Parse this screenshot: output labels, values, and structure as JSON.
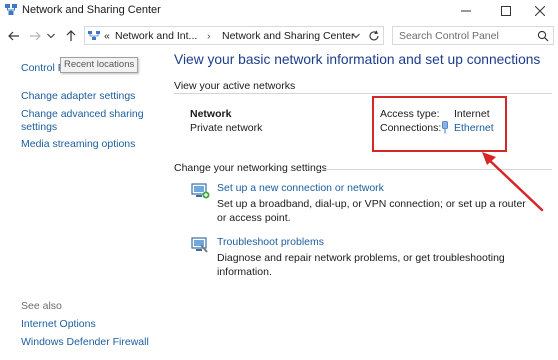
{
  "window": {
    "title": "Network and Sharing Center",
    "minimize_icon": "minimize-icon",
    "maximize_icon": "maximize-icon",
    "close_icon": "close-icon"
  },
  "address_bar": {
    "overflow_chevrons": "«",
    "crumbs": [
      "Network and Int...",
      "Network and Sharing Center"
    ],
    "search_placeholder": "Search Control Panel"
  },
  "tooltip": "Recent locations",
  "left_pane": {
    "home": "Control Panel Home",
    "links": [
      "Change adapter settings",
      "Change advanced sharing settings",
      "Media streaming options"
    ],
    "see_also_header": "See also",
    "see_also": [
      "Internet Options",
      "Windows Defender Firewall"
    ]
  },
  "main": {
    "title": "View your basic network information and set up connections",
    "active_networks_header": "View your active networks",
    "network_name": "Network",
    "network_type": "Private network",
    "access_type_label": "Access type:",
    "access_type_value": "Internet",
    "connections_label": "Connections:",
    "connections_value": "Ethernet",
    "change_settings_header": "Change your networking settings",
    "tasks": [
      {
        "title": "Set up a new connection or network",
        "description": "Set up a broadband, dial-up, or VPN connection; or set up a router or access point."
      },
      {
        "title": "Troubleshoot problems",
        "description": "Diagnose and repair network problems, or get troubleshooting information."
      }
    ]
  },
  "colors": {
    "link": "#1c5ea0",
    "title": "#1c3d8c",
    "annotation": "#d62728"
  }
}
